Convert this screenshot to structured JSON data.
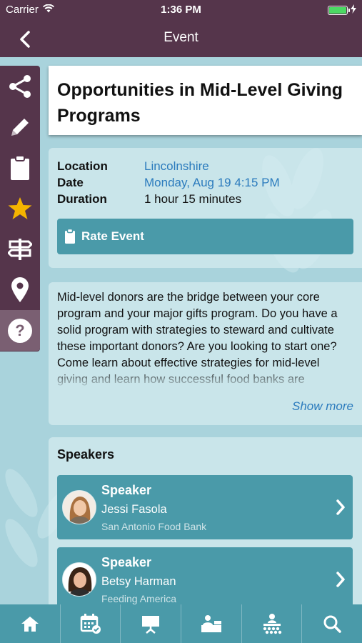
{
  "status_bar": {
    "carrier": "Carrier",
    "time": "1:36 PM"
  },
  "nav": {
    "title": "Event"
  },
  "sidebar": {
    "items": [
      {
        "icon": "share-icon"
      },
      {
        "icon": "pencil-icon"
      },
      {
        "icon": "clipboard-icon"
      },
      {
        "icon": "star-icon",
        "color": "#f4b400"
      },
      {
        "icon": "signpost-icon"
      },
      {
        "icon": "location-pin-icon"
      },
      {
        "icon": "help-icon"
      }
    ]
  },
  "event": {
    "title": "Opportunities in Mid-Level Giving Programs",
    "location_label": "Location",
    "location_value": "Lincolnshire",
    "date_label": "Date",
    "date_value": "Monday, Aug 19 4:15 PM",
    "duration_label": "Duration",
    "duration_value": "1 hour 15 minutes",
    "rate_button": "Rate Event",
    "description": "Mid-level donors are the bridge between your core program and your major gifts program. Do you have a solid program with strategies to steward and cultivate these important donors? Are you looking to start one? Come learn about effective strategies for mid-level giving and learn how successful food banks are",
    "show_more": "Show more"
  },
  "speakers": {
    "heading": "Speakers",
    "items": [
      {
        "role": "Speaker",
        "name": "Jessi Fasola",
        "org": "San Antonio Food Bank"
      },
      {
        "role": "Speaker",
        "name": "Betsy Harman",
        "org": "Feeding America"
      }
    ]
  },
  "tabbar": {
    "items": [
      {
        "icon": "home-icon"
      },
      {
        "icon": "calendar-icon"
      },
      {
        "icon": "presentation-icon"
      },
      {
        "icon": "exhibitor-icon"
      },
      {
        "icon": "attendees-icon"
      },
      {
        "icon": "search-icon"
      }
    ]
  },
  "colors": {
    "header": "#55354b",
    "accent": "#4a9aa9",
    "link": "#2b7bbd",
    "background": "#a9d3dc"
  }
}
